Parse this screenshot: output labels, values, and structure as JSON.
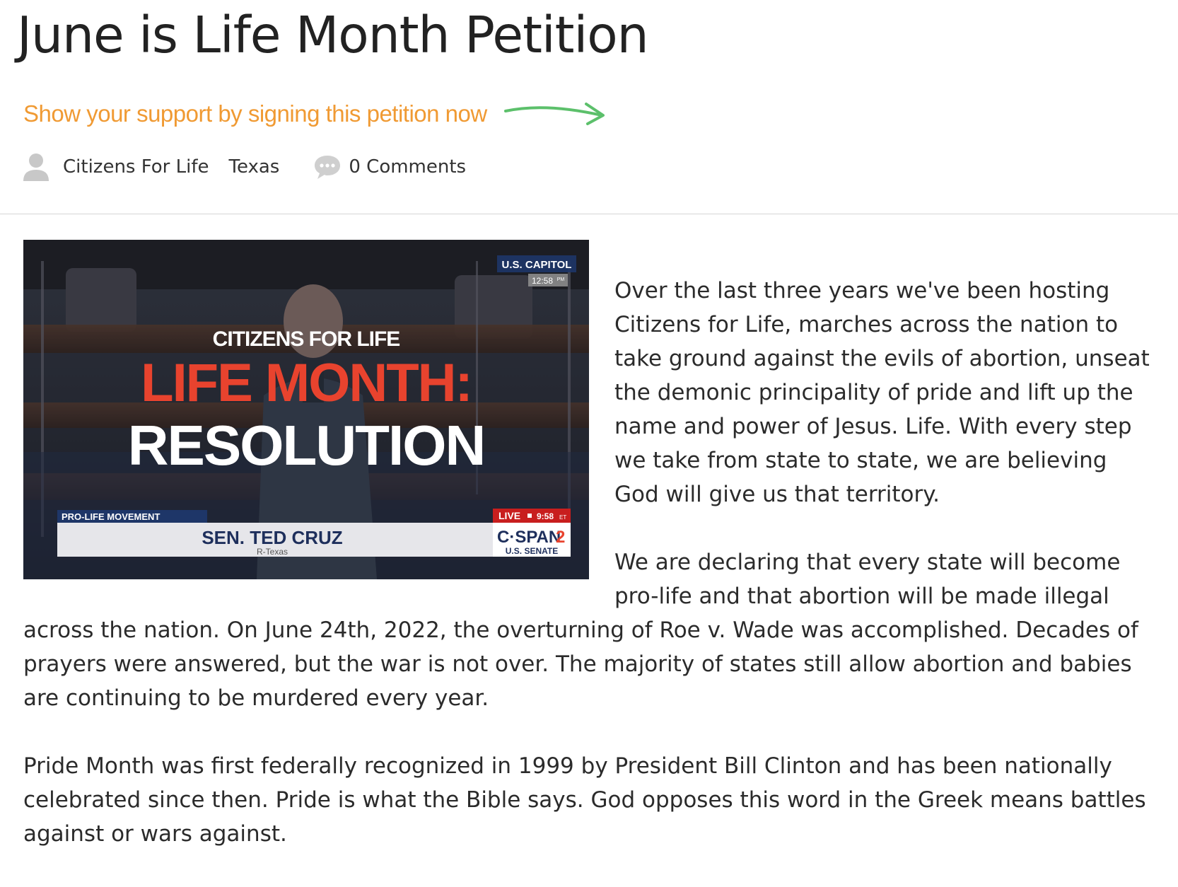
{
  "page": {
    "title": "June is Life Month Petition",
    "cta": "Show your support by signing this petition now",
    "meta": {
      "author": "Citizens For Life",
      "location": "Texas",
      "comments": "0 Comments"
    }
  },
  "video": {
    "brand": "CITIZENS FOR LIFE",
    "headline_1": "LIFE MONTH:",
    "headline_2": "RESOLUTION",
    "location_tag": "U.S. CAPITOL",
    "location_time": "12:58",
    "location_time_suffix": "PM",
    "movement_tag": "PRO-LIFE MOVEMENT",
    "speaker": "SEN. TED CRUZ",
    "speaker_sub": "R-Texas",
    "live": "LIVE",
    "live_time": "9:58",
    "live_time_suffix": "ET",
    "network_main": "C·SPAN",
    "network_num": "2",
    "network_sub": "U.S. SENATE"
  },
  "article": {
    "p1": "Over the last three years we've been hosting Citizens for Life, marches across the nation to take ground against the evils of abortion, unseat the demonic principality of pride and lift up the name and power of Jesus. Life. With every step we take from state to state, we are believing God will give us that territory.",
    "p2": "We are declaring that every state will become pro-life and that abortion will be made illegal across the nation. On June 24th, 2022, the overturning of Roe v. Wade was accomplished. Decades of prayers were answered, but the war is not over. The majority of states still allow abortion and babies are continuing to be murdered every year.",
    "p3": "Pride Month was first federally recognized in 1999 by President Bill Clinton and has been nationally celebrated since then. Pride is what the Bible says. God opposes this word in the Greek means battles against or wars against."
  },
  "colors": {
    "cta": "#f09a33",
    "arrow": "#5cc06b",
    "headline_red": "#e8432e",
    "icon_gray": "#c8c8c8"
  }
}
